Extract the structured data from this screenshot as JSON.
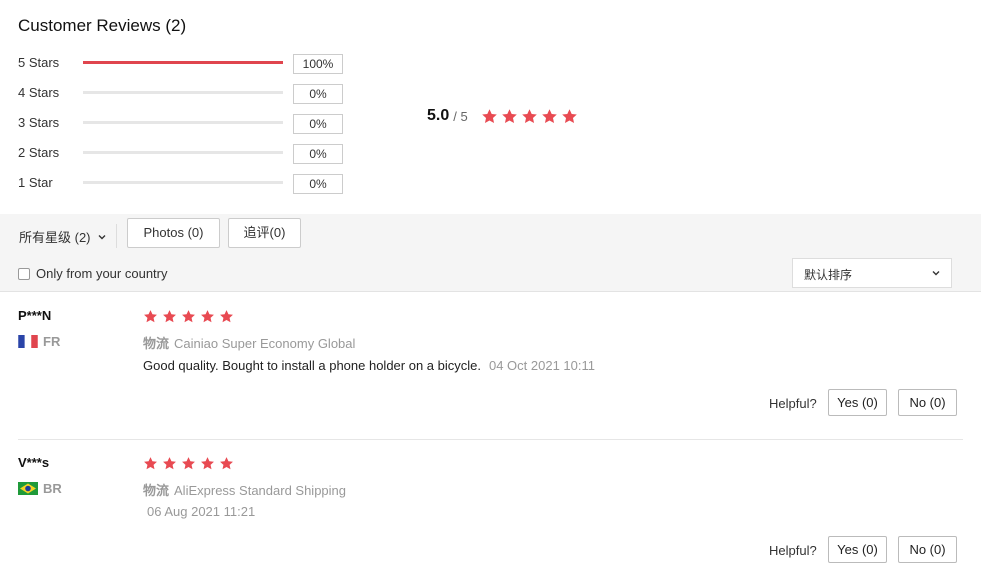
{
  "header": {
    "title": "Customer Reviews",
    "count": "(2)"
  },
  "distribution": [
    {
      "label": "5 Stars",
      "percent": "100%",
      "fraction": 1.0
    },
    {
      "label": "4 Stars",
      "percent": "0%",
      "fraction": 0
    },
    {
      "label": "3 Stars",
      "percent": "0%",
      "fraction": 0
    },
    {
      "label": "2 Stars",
      "percent": "0%",
      "fraction": 0
    },
    {
      "label": "1 Star",
      "percent": "0%",
      "fraction": 0
    }
  ],
  "summary": {
    "average": "5.0",
    "out_of": "/ 5",
    "stars": 5
  },
  "filters": {
    "all_ratings_label": "所有星级 (2)",
    "photos_label": "Photos (0)",
    "followup_label": "追评(0)",
    "only_country_label": "Only from your country",
    "only_country_checked": false,
    "sort_value": "默认排序"
  },
  "colors": {
    "accent": "#e0454e",
    "star": "#e84a52"
  },
  "reviews": [
    {
      "user": "P***N",
      "country_code": "FR",
      "flag_icon": "france-flag-icon",
      "stars": 5,
      "shipping_label": "物流",
      "shipping": "Cainiao Super Economy Global",
      "text": "Good quality. Bought to install a phone holder on a bicycle.",
      "date": "04 Oct 2021 10:11",
      "helpful_label": "Helpful?",
      "yes_label": "Yes (0)",
      "no_label": "No (0)"
    },
    {
      "user": "V***s",
      "country_code": "BR",
      "flag_icon": "brazil-flag-icon",
      "stars": 5,
      "shipping_label": "物流",
      "shipping": "AliExpress Standard Shipping",
      "text": "",
      "date": "06 Aug 2021 11:21",
      "helpful_label": "Helpful?",
      "yes_label": "Yes (0)",
      "no_label": "No (0)"
    }
  ]
}
